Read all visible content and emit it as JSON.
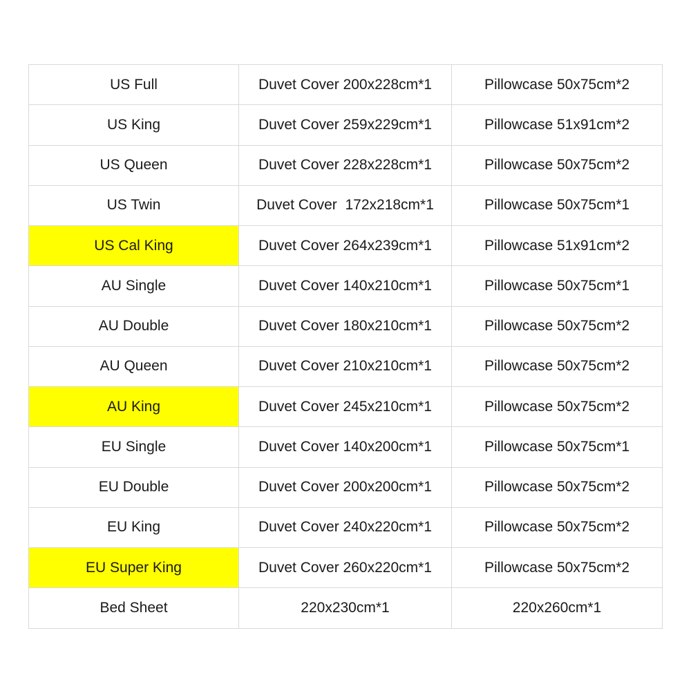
{
  "table": {
    "highlight_color": "#FFFF00",
    "text_color": "#1A1A1A",
    "border_color": "#D9D9D9",
    "background_color": "#FFFFFF",
    "rows": [
      {
        "size": "US Full",
        "duvet": "Duvet Cover 200x228cm*1",
        "pillow": "Pillowcase 50x75cm*2",
        "highlighted": false
      },
      {
        "size": "US King",
        "duvet": "Duvet Cover 259x229cm*1",
        "pillow": "Pillowcase 51x91cm*2",
        "highlighted": false
      },
      {
        "size": "US Queen",
        "duvet": "Duvet Cover 228x228cm*1",
        "pillow": "Pillowcase 50x75cm*2",
        "highlighted": false
      },
      {
        "size": "US Twin",
        "duvet": "Duvet Cover  172x218cm*1",
        "pillow": "Pillowcase 50x75cm*1",
        "highlighted": false
      },
      {
        "size": "US Cal King",
        "duvet": "Duvet Cover 264x239cm*1",
        "pillow": "Pillowcase 51x91cm*2",
        "highlighted": true
      },
      {
        "size": "AU Single",
        "duvet": "Duvet Cover 140x210cm*1",
        "pillow": "Pillowcase 50x75cm*1",
        "highlighted": false
      },
      {
        "size": "AU Double",
        "duvet": "Duvet Cover 180x210cm*1",
        "pillow": "Pillowcase 50x75cm*2",
        "highlighted": false
      },
      {
        "size": "AU Queen",
        "duvet": "Duvet Cover 210x210cm*1",
        "pillow": "Pillowcase 50x75cm*2",
        "highlighted": false
      },
      {
        "size": "AU King",
        "duvet": "Duvet Cover 245x210cm*1",
        "pillow": "Pillowcase 50x75cm*2",
        "highlighted": true
      },
      {
        "size": "EU Single",
        "duvet": "Duvet Cover 140x200cm*1",
        "pillow": "Pillowcase 50x75cm*1",
        "highlighted": false
      },
      {
        "size": "EU Double",
        "duvet": "Duvet Cover 200x200cm*1",
        "pillow": "Pillowcase 50x75cm*2",
        "highlighted": false
      },
      {
        "size": "EU King",
        "duvet": "Duvet Cover 240x220cm*1",
        "pillow": "Pillowcase 50x75cm*2",
        "highlighted": false
      },
      {
        "size": "EU Super King",
        "duvet": "Duvet Cover 260x220cm*1",
        "pillow": "Pillowcase 50x75cm*2",
        "highlighted": true
      },
      {
        "size": "Bed Sheet",
        "duvet": "220x230cm*1",
        "pillow": "220x260cm*1",
        "highlighted": false
      }
    ]
  }
}
